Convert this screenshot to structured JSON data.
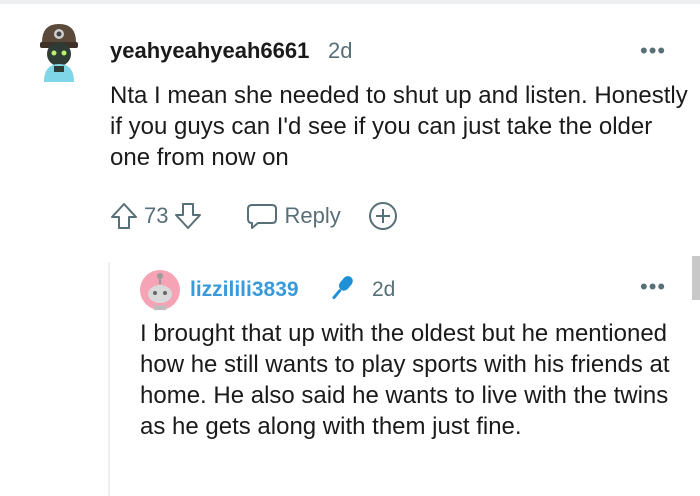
{
  "comment": {
    "username": "yeahyeahyeah6661",
    "age": "2d",
    "more_label": "•••",
    "body": "Nta I mean she needed to shut up and listen. Honestly if you guys can I'd see if you can just take the older one from now on",
    "score": "73",
    "reply_label": "Reply"
  },
  "reply": {
    "username": "lizzilili3839",
    "age": "2d",
    "more_label": "•••",
    "body": "I brought that up with the oldest but he mentioned how he still wants to play sports with his friends at home. He also said he wants to live with the twins as he gets along with them just fine."
  },
  "colors": {
    "text": "#1a1a1b",
    "meta": "#576f76",
    "reply_username": "#3a9ad9",
    "avatar2_bg": "#f5a3b5",
    "mic": "#1e90d6"
  },
  "icons": {
    "upvote": "upvote-icon",
    "downvote": "downvote-icon",
    "reply": "reply-bubble-icon",
    "award": "add-award-icon",
    "mic": "microphone-icon"
  }
}
